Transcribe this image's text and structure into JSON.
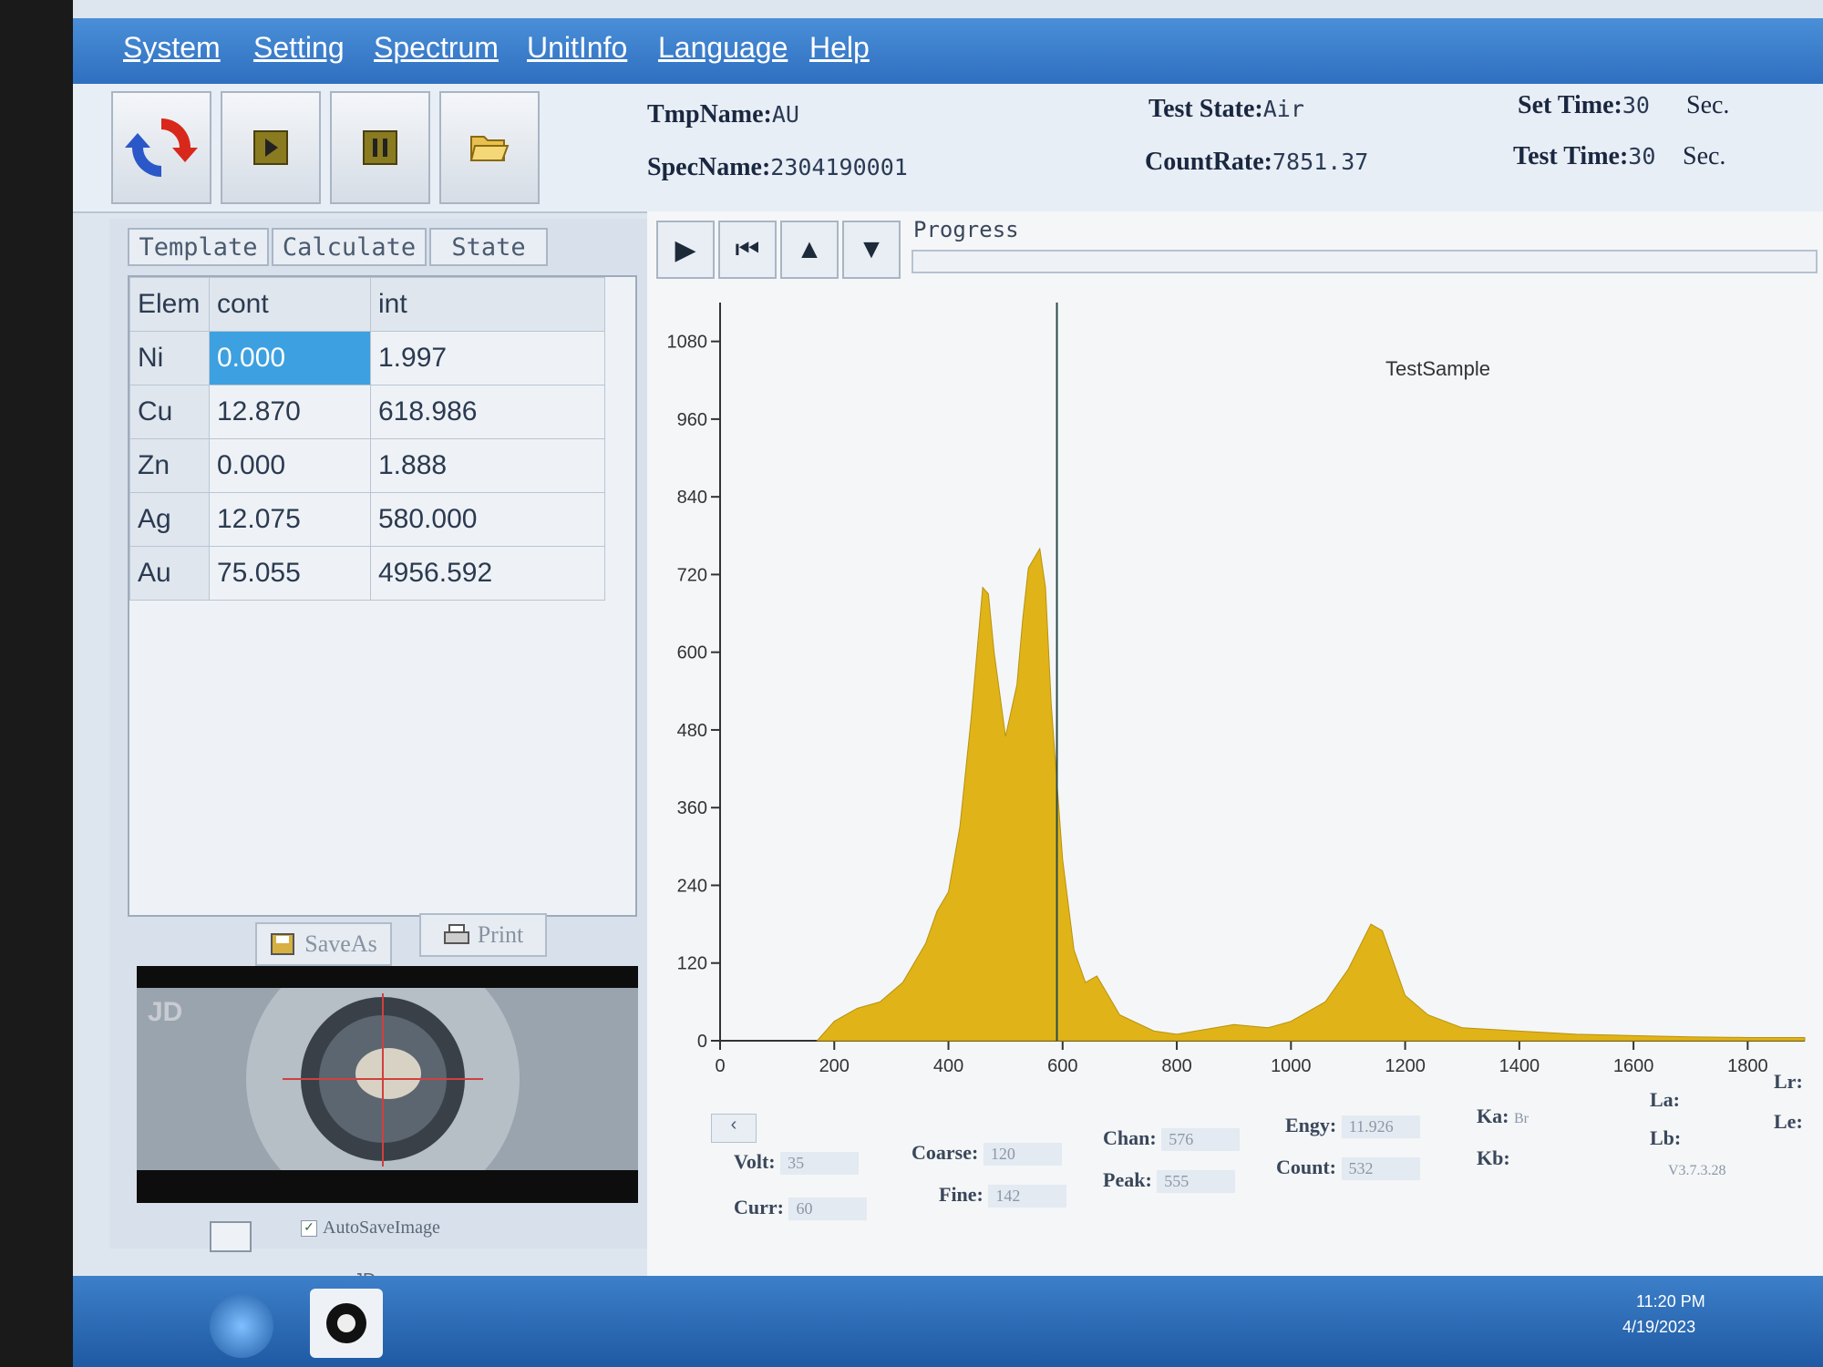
{
  "menu": [
    "System",
    "Setting",
    "Spectrum",
    "UnitInfo",
    "Language",
    "Help"
  ],
  "toolbar": {
    "refresh_icon": "refresh-icon",
    "start_icon": "play-icon",
    "stop_icon": "stop-icon",
    "open_icon": "folder-icon"
  },
  "header": {
    "tmp_name_label": "TmpName:",
    "tmp_name": "AU",
    "spec_name_label": "SpecName:",
    "spec_name": "2304190001",
    "test_state_label": "Test State:",
    "test_state": "Air",
    "count_rate_label": "CountRate:",
    "count_rate": "7851.37",
    "set_time_label": "Set Time:",
    "set_time": "30",
    "set_time_unit": "Sec.",
    "test_time_label": "Test Time:",
    "test_time": "30",
    "test_time_unit": "Sec."
  },
  "tabs": [
    "Template",
    "Calculate",
    "State"
  ],
  "results": {
    "headers": [
      "Elem",
      "cont",
      "int"
    ],
    "rows": [
      {
        "elem": "Ni",
        "cont": "0.000",
        "int": "1.997"
      },
      {
        "elem": "Cu",
        "cont": "12.870",
        "int": "618.986"
      },
      {
        "elem": "Zn",
        "cont": "0.000",
        "int": "1.888"
      },
      {
        "elem": "Ag",
        "cont": "12.075",
        "int": "580.000"
      },
      {
        "elem": "Au",
        "cont": "75.055",
        "int": "4956.592"
      }
    ]
  },
  "buttons": {
    "save_as": "SaveAs",
    "print": "Print"
  },
  "camera": {
    "overlay_text": "JD",
    "autosave_label": "AutoSaveImage",
    "caption": "JD"
  },
  "progress_label": "Progress",
  "chart_data": {
    "type": "area",
    "title": "TestSample",
    "xlim": [
      0,
      1900
    ],
    "ylim": [
      0,
      1140
    ],
    "xticks": [
      0,
      200,
      400,
      600,
      800,
      1000,
      1200,
      1400,
      1600,
      1800
    ],
    "yticks": [
      0,
      120,
      240,
      360,
      480,
      600,
      720,
      840,
      960,
      1080
    ],
    "cursor_x": 590,
    "color": "#e0b418",
    "x": [
      170,
      200,
      240,
      280,
      320,
      360,
      380,
      400,
      420,
      440,
      460,
      470,
      480,
      500,
      520,
      530,
      540,
      560,
      570,
      580,
      600,
      620,
      640,
      660,
      680,
      700,
      760,
      800,
      900,
      960,
      1000,
      1060,
      1100,
      1140,
      1160,
      1180,
      1200,
      1240,
      1300,
      1400,
      1500,
      1600,
      1700,
      1800,
      1900
    ],
    "y": [
      0,
      30,
      50,
      60,
      90,
      150,
      200,
      230,
      330,
      500,
      700,
      690,
      600,
      470,
      550,
      650,
      730,
      760,
      700,
      520,
      280,
      140,
      90,
      100,
      70,
      40,
      15,
      10,
      25,
      20,
      30,
      60,
      110,
      180,
      170,
      120,
      70,
      40,
      20,
      15,
      10,
      8,
      6,
      5,
      5
    ]
  },
  "status": {
    "volt_label": "Volt:",
    "volt": "35",
    "curr_label": "Curr:",
    "curr": "60",
    "coarse_label": "Coarse:",
    "coarse": "120",
    "fine_label": "Fine:",
    "fine": "142",
    "chan_label": "Chan:",
    "chan": "576",
    "peak_label": "Peak:",
    "peak": "555",
    "engy_label": "Engy:",
    "engy": "11.926",
    "count_label": "Count:",
    "count": "532",
    "ka_label": "Ka:",
    "ka": "Br",
    "kb_label": "Kb:",
    "la_label": "La:",
    "lb_label": "Lb:",
    "lr_label": "Lr:",
    "le_label": "Le:",
    "version": "V3.7.3.28"
  },
  "taskbar": {
    "time": "11:20 PM",
    "date": "4/19/2023"
  }
}
